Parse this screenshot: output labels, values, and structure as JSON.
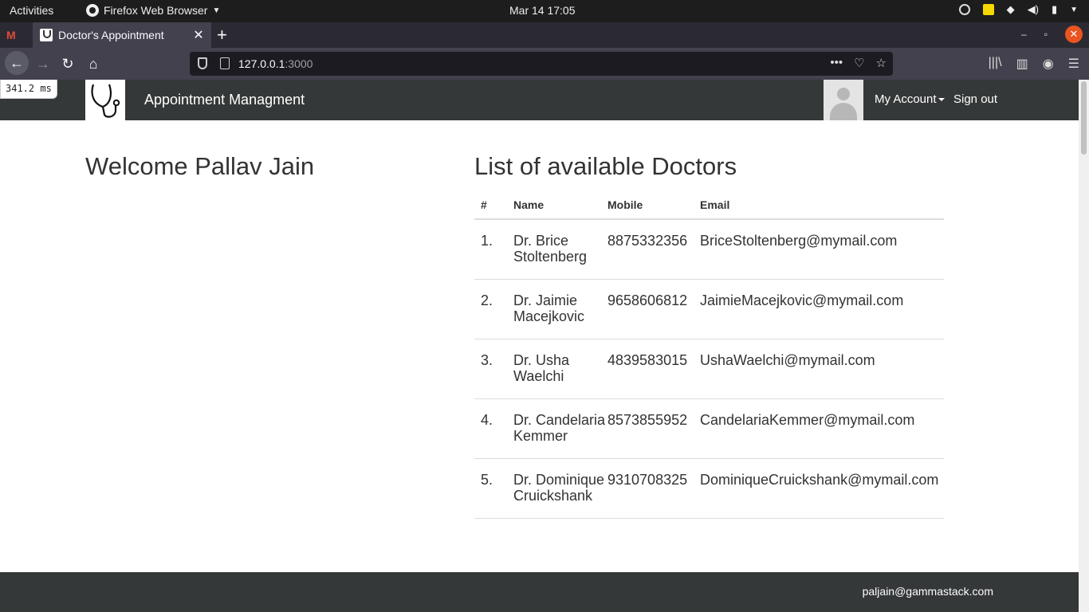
{
  "os": {
    "activities": "Activities",
    "app_name": "Firefox Web Browser",
    "clock": "Mar 14  17:05"
  },
  "browser": {
    "tab_title": "Doctor's Appointment",
    "url_host": "127.0.0.1",
    "url_port": ":3000",
    "tab_close": "✕",
    "new_tab": "+",
    "back": "←",
    "forward": "→",
    "reload": "↻",
    "home": "⌂",
    "more": "•••",
    "pocket": "♡",
    "bookmark": "☆",
    "library": "|||\\",
    "sidebar": "▥",
    "account": "◉",
    "menu": "☰",
    "minimize": "–",
    "maximize": "▫",
    "close": "✕"
  },
  "perf_badge": "341.2 ms",
  "header": {
    "brand": "Appointment Managment",
    "my_account": "My Account",
    "sign_out": "Sign out"
  },
  "welcome": "Welcome Pallav Jain",
  "doctors": {
    "title": "List of available Doctors",
    "columns": [
      "#",
      "Name",
      "Mobile",
      "Email"
    ],
    "rows": [
      {
        "num": "1.",
        "name": "Dr. Brice Stoltenberg",
        "mobile": "8875332356",
        "email": "BriceStoltenberg@mymail.com"
      },
      {
        "num": "2.",
        "name": "Dr. Jaimie Macejkovic",
        "mobile": "9658606812",
        "email": "JaimieMacejkovic@mymail.com"
      },
      {
        "num": "3.",
        "name": "Dr. Usha Waelchi",
        "mobile": "4839583015",
        "email": "UshaWaelchi@mymail.com"
      },
      {
        "num": "4.",
        "name": "Dr. Candelaria Kemmer",
        "mobile": "8573855952",
        "email": "CandelariaKemmer@mymail.com"
      },
      {
        "num": "5.",
        "name": "Dr. Dominique Cruickshank",
        "mobile": "9310708325",
        "email": "DominiqueCruickshank@mymail.com"
      }
    ]
  },
  "footer_email": "paljain@gammastack.com"
}
